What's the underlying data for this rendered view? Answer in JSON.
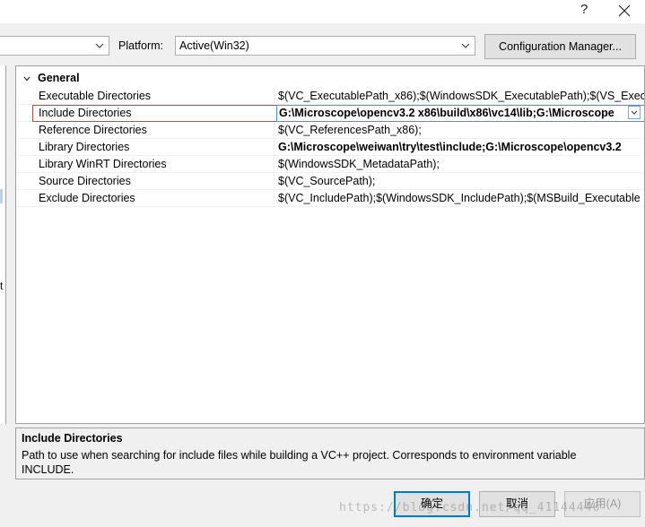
{
  "window": {
    "help_label": "?",
    "close_icon": "close-icon"
  },
  "toolbar": {
    "configuration_value": "",
    "platform_label": "Platform:",
    "platform_value": "Active(Win32)",
    "config_manager_label": "Configuration Manager..."
  },
  "grid": {
    "category": "General",
    "rows": [
      {
        "name": "Executable Directories",
        "value": "$(VC_ExecutablePath_x86);$(WindowsSDK_ExecutablePath);$(VS_Execu",
        "bold": false
      },
      {
        "name": "Include Directories",
        "value": "G:\\Microscope\\opencv3.2 x86\\build\\x86\\vc14\\lib;G:\\Microscope",
        "bold": true
      },
      {
        "name": "Reference Directories",
        "value": "$(VC_ReferencesPath_x86);",
        "bold": false
      },
      {
        "name": "Library Directories",
        "value": "G:\\Microscope\\weiwan\\try\\test\\include;G:\\Microscope\\opencv3.2",
        "bold": true
      },
      {
        "name": "Library WinRT Directories",
        "value": "$(WindowsSDK_MetadataPath);",
        "bold": false
      },
      {
        "name": "Source Directories",
        "value": "$(VC_SourcePath);",
        "bold": false
      },
      {
        "name": "Exclude Directories",
        "value": "$(VC_IncludePath);$(WindowsSDK_IncludePath);$(MSBuild_Executable",
        "bold": false
      }
    ]
  },
  "description": {
    "title": "Include Directories",
    "text": "Path to use when searching for include files while building a VC++ project.  Corresponds to environment variable INCLUDE."
  },
  "buttons": {
    "ok": "确定",
    "cancel": "取消",
    "apply": "应用(A)"
  },
  "watermark": "https://blog.csdn.net/qq_41144446",
  "left_panel_char": "t",
  "colors": {
    "selection_border": "#e03c3c",
    "value_focus_border": "#3399ff",
    "ok_button_border": "#0078d7"
  }
}
